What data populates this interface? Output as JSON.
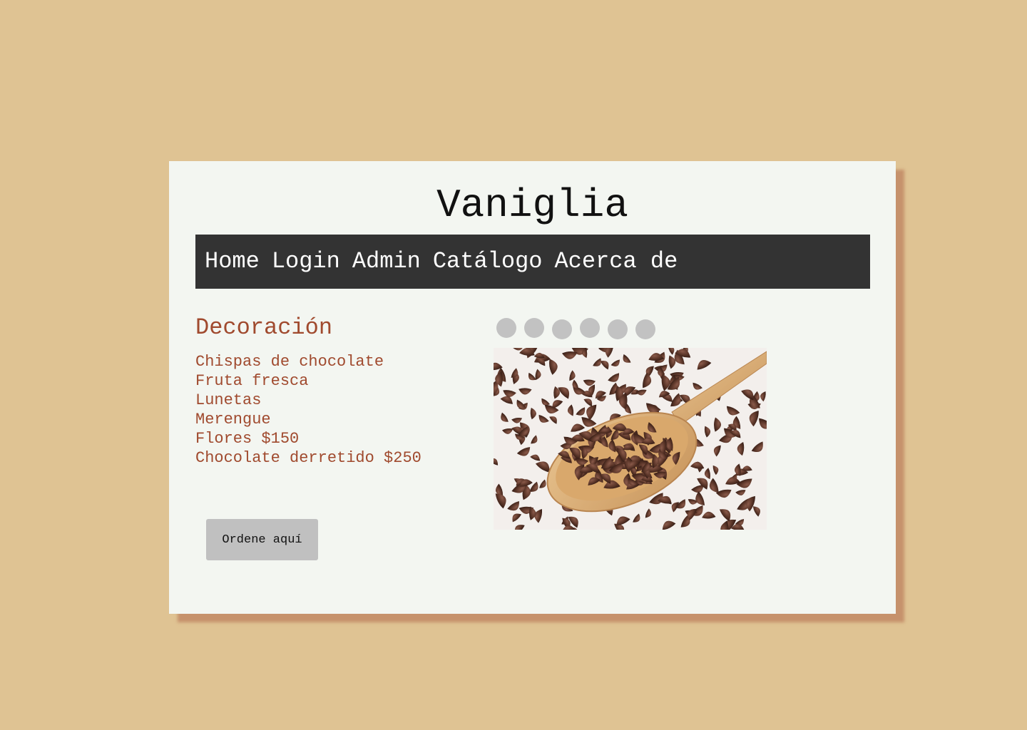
{
  "site": {
    "title": "Vaniglia"
  },
  "nav": {
    "items": [
      {
        "label": "Home"
      },
      {
        "label": "Login"
      },
      {
        "label": "Admin"
      },
      {
        "label": "Catálogo"
      },
      {
        "label": "Acerca de"
      }
    ]
  },
  "section": {
    "title": "Decoración",
    "items": [
      "Chispas de chocolate",
      "Fruta fresca",
      "Lunetas",
      "Merengue",
      "Flores $150",
      "Chocolate derretido $250"
    ]
  },
  "order_button": {
    "label": "Ordene aquí"
  },
  "carousel": {
    "dot_count": 6,
    "image_icon": "chocolate-chips-spoon-photo"
  },
  "colors": {
    "background": "#dfc393",
    "card": "#f3f6f1",
    "navbar": "#333333",
    "accent_text": "#a04a2e",
    "button": "#c0c0c0",
    "dots": "#c2c2c2",
    "card_shadow": "#be825f"
  }
}
